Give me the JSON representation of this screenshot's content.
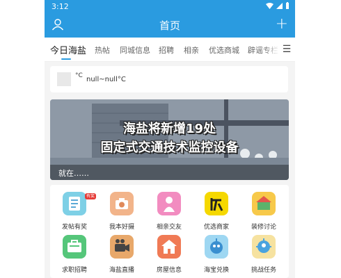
{
  "status_bar": {
    "time": "3:12"
  },
  "header": {
    "title": "首页"
  },
  "tabs": [
    {
      "label": "今日海盐"
    },
    {
      "label": "热帖"
    },
    {
      "label": "同城信息"
    },
    {
      "label": "招聘"
    },
    {
      "label": "相亲"
    },
    {
      "label": "优选商城"
    },
    {
      "label": "辟谣专栏"
    }
  ],
  "weather": {
    "unit": "°C",
    "text": "null~null°C"
  },
  "banner": {
    "headline_1": "海盐将新增19处",
    "headline_2": "固定式交通技术监控设备",
    "caption": "就在……"
  },
  "grid": {
    "items": [
      {
        "label": "发帖有奖",
        "icon": "post-reward-icon",
        "color": "#7ed0e6",
        "badge": "有奖"
      },
      {
        "label": "我本好摄",
        "icon": "photography-icon",
        "color": "#f2b48a"
      },
      {
        "label": "相亲交友",
        "icon": "dating-icon",
        "color": "#f28cc0"
      },
      {
        "label": "优选商家",
        "icon": "merchant-icon",
        "color": "#f5d800"
      },
      {
        "label": "装修讨论",
        "icon": "decoration-icon",
        "color": "#f7c94a"
      },
      {
        "label": "求职招聘",
        "icon": "job-icon",
        "color": "#55c67a"
      },
      {
        "label": "海盐直播",
        "icon": "live-broadcast-icon",
        "color": "#e8a86a"
      },
      {
        "label": "房屋信息",
        "icon": "house-icon",
        "color": "#f07a55"
      },
      {
        "label": "海宝兑换",
        "icon": "exchange-icon",
        "color": "#9ed7f2"
      },
      {
        "label": "挑战任务",
        "icon": "challenge-icon",
        "color": "#f6e2a0"
      }
    ]
  },
  "colors": {
    "primary": "#2a9be0",
    "background": "#f4f4f4"
  }
}
